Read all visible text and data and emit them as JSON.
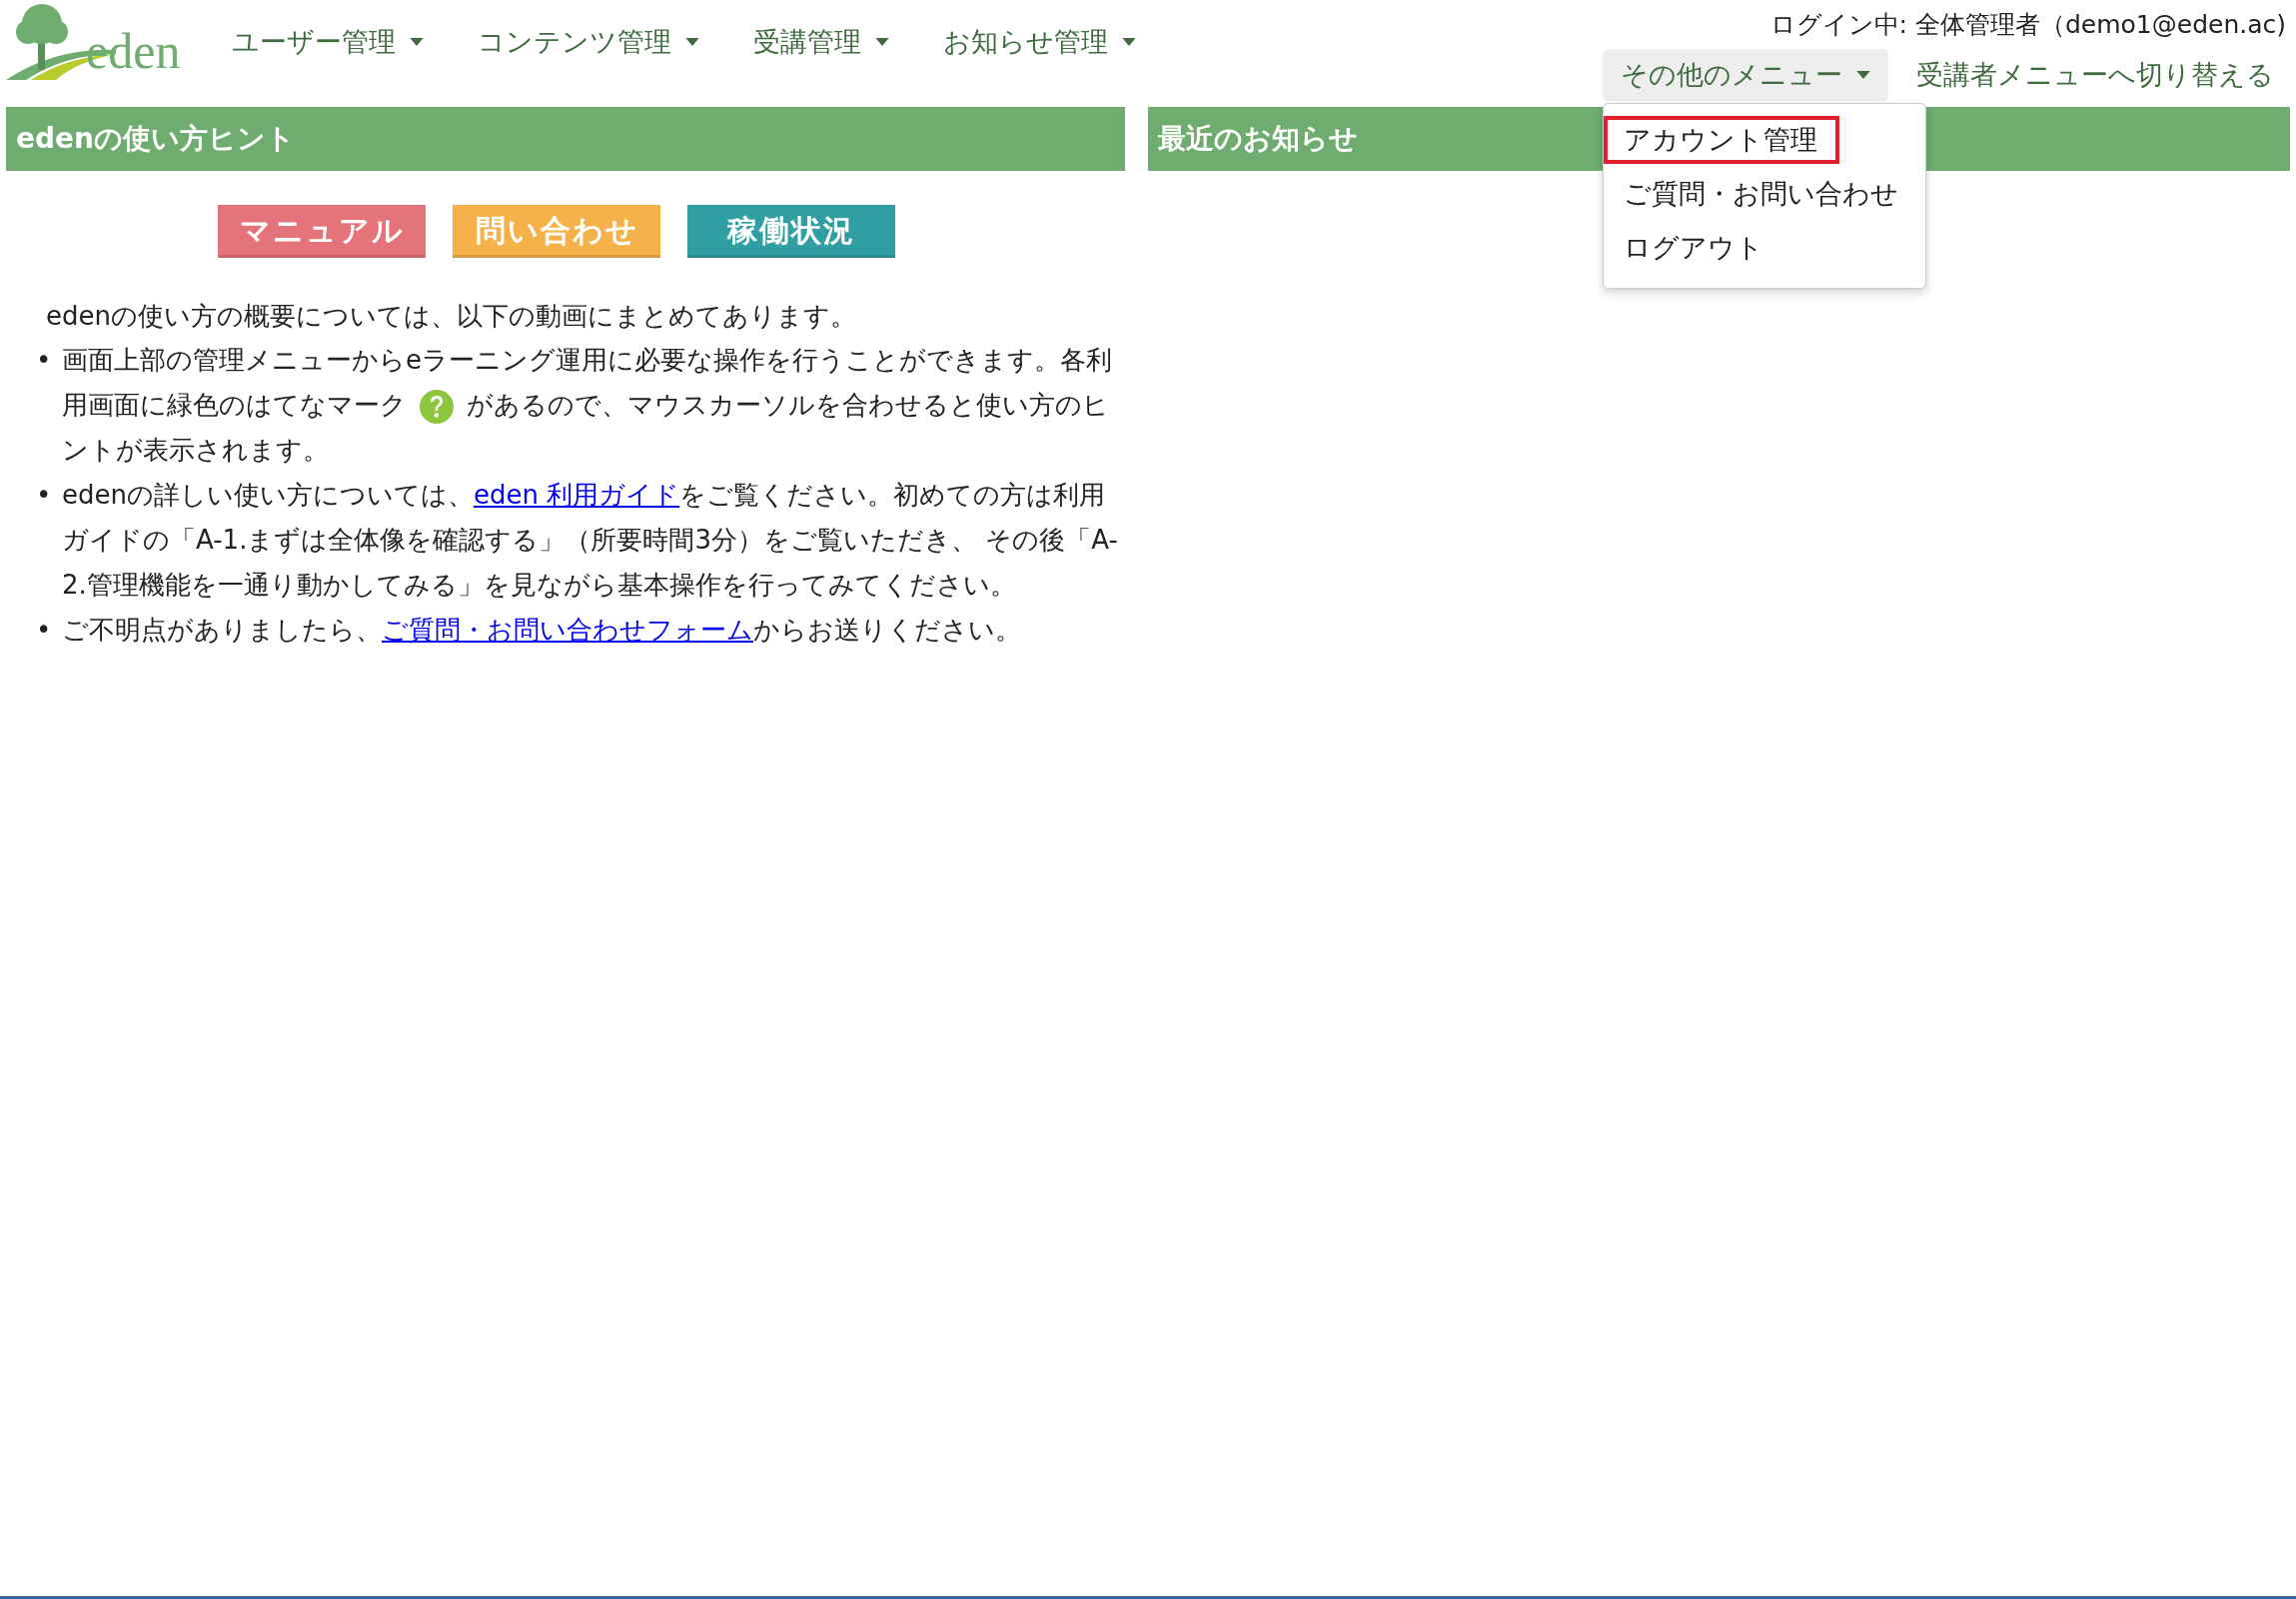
{
  "nav": {
    "logo": "eden",
    "items": [
      {
        "label": "ユーザー管理"
      },
      {
        "label": "コンテンツ管理"
      },
      {
        "label": "受講管理"
      },
      {
        "label": "お知らせ管理"
      }
    ]
  },
  "user": {
    "login": "ログイン中: 全体管理者（demo1@eden.ac)",
    "other_menu": "その他のメニュー",
    "switch_link": "受講者メニューへ切り替える",
    "dropdown": [
      {
        "label": "アカウント管理",
        "highlighted": true
      },
      {
        "label": "ご質問・お問い合わせ",
        "highlighted": false
      },
      {
        "label": "ログアウト",
        "highlighted": false
      }
    ]
  },
  "hints": {
    "title": "edenの使い方ヒント",
    "buttons": [
      {
        "label": "マニュアル",
        "color": "#e5737a"
      },
      {
        "label": "問い合わせ",
        "color": "#f5b24a"
      },
      {
        "label": "稼働状況",
        "color": "#2f9fa4"
      }
    ],
    "intro": "edenの使い方の概要については、以下の動画にまとめてあります。",
    "bullets": [
      {
        "marker": "•",
        "parts": [
          {
            "kind": "text",
            "text": "画面上部の管理メニューからeラーニング運用に必要な操作を行うことができます。各利用画面に緑色のはてなマーク"
          },
          {
            "kind": "help_icon"
          },
          {
            "kind": "text",
            "text": "があるので、マウスカーソルを合わせると使い方のヒントが表示されます。"
          }
        ]
      },
      {
        "marker": "•",
        "parts": [
          {
            "kind": "text",
            "text": "edenの詳しい使い方については、"
          },
          {
            "kind": "link",
            "text": "eden 利用ガイド"
          },
          {
            "kind": "text",
            "text": "をご覧ください。初めての方は利用ガイドの「A-1.まずは全体像を確認する」（所要時間3分）をご覧いただき、 その後「A-2.管理機能を一通り動かしてみる」を見ながら基本操作を行ってみてください。"
          }
        ]
      },
      {
        "marker": "•",
        "parts": [
          {
            "kind": "text",
            "text": "ご不明点がありましたら、"
          },
          {
            "kind": "link",
            "text": "ご質問・お問い合わせフォーム"
          },
          {
            "kind": "text",
            "text": "からお送りください。"
          }
        ]
      }
    ]
  },
  "news": {
    "title": "最近のお知らせ"
  }
}
